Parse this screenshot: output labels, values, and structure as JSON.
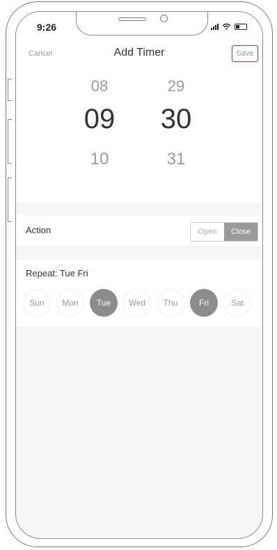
{
  "status": {
    "time": "9:26"
  },
  "nav": {
    "cancel": "Cancel",
    "title": "Add Timer",
    "save": "Save"
  },
  "picker": {
    "hours": [
      "08",
      "09",
      "10"
    ],
    "minutes": [
      "29",
      "30",
      "31"
    ]
  },
  "action": {
    "label": "Action",
    "options": [
      "Open",
      "Close"
    ],
    "selected": "Close"
  },
  "repeat": {
    "label": "Repeat: Tue Fri",
    "days": [
      "Sun",
      "Mon",
      "Tue",
      "Wed",
      "Thu",
      "Fri",
      "Sat"
    ],
    "selected": [
      "Tue",
      "Fri"
    ]
  },
  "colors": {
    "highlight": "#c92a3a",
    "selected_day": "#8c8c8c"
  }
}
